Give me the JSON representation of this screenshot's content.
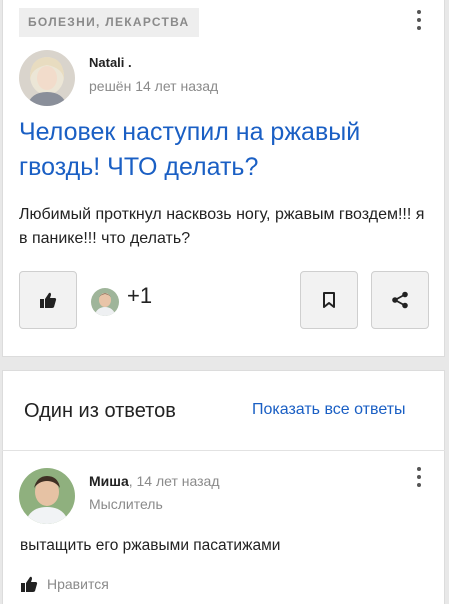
{
  "question": {
    "category": "БОЛЕЗНИ, ЛЕКАРСТВА",
    "author": "Natali .",
    "meta": "решён 14 лет назад",
    "title": "Человек наступил на ржавый гвоздь! ЧТО делать?",
    "body": "Любимый проткнул насквозь ногу, ржавым гвоздем!!! я в панике!!! что делать?",
    "likes_extra": "+1",
    "icons": {
      "like": "thumbs-up-icon",
      "bookmark": "bookmark-icon",
      "share": "share-icon",
      "menu": "kebab-menu-icon"
    }
  },
  "answers": {
    "heading": "Один из ответов",
    "show_all": "Показать все ответы",
    "answer": {
      "author": "Миша",
      "time": "14 лет назад",
      "rank": "Мыслитель",
      "body": "вытащить его ржавыми пасатижами",
      "like_label": "Нравится"
    }
  },
  "colors": {
    "link": "#1a5fc4",
    "muted": "#8a8a8a"
  }
}
